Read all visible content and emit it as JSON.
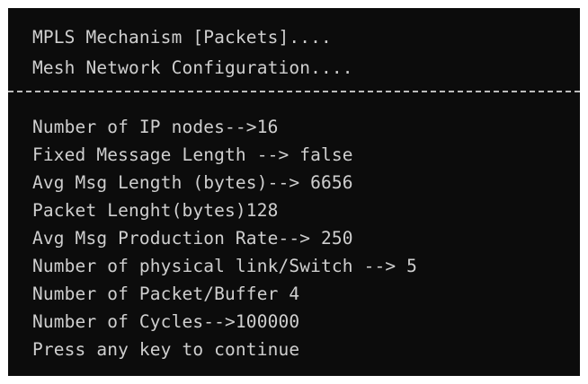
{
  "console": {
    "header_lines": [
      "MPLS Mechanism [Packets]....",
      "Mesh Network Configuration...."
    ],
    "config_lines": [
      "Number of IP nodes-->16",
      "Fixed Message Length --> false",
      "Avg Msg Length (bytes)--> 6656",
      "Packet Lenght(bytes)128",
      "Avg Msg Production Rate--> 250",
      "Number of physical link/Switch --> 5",
      "Number of Packet/Buffer 4",
      "Number of Cycles-->100000"
    ],
    "prompt": "Press any key to continue",
    "colors": {
      "background": "#0c0c0c",
      "text": "#cfcfcf"
    }
  }
}
